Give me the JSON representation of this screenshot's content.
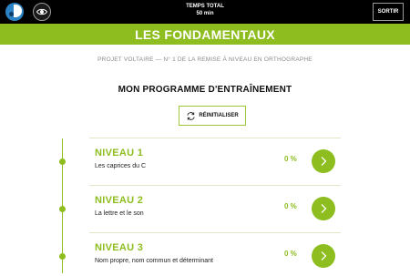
{
  "header": {
    "timer_label": "TEMPS TOTAL",
    "timer_value": "50 min",
    "exit_label": "SORTIR"
  },
  "banner": {
    "title": "LES FONDAMENTAUX"
  },
  "subtitle": "PROJET VOLTAIRE — N° 1 DE LA REMISE À NIVEAU EN ORTHOGRAPHE",
  "program_title": "MON PROGRAMME D'ENTRAÎNEMENT",
  "reset_label": "RÉINITIALISER",
  "levels": [
    {
      "name": "NIVEAU 1",
      "desc": "Les caprices du C",
      "percent": "0 %"
    },
    {
      "name": "NIVEAU 2",
      "desc": "La lettre et le son",
      "percent": "0 %"
    },
    {
      "name": "NIVEAU 3",
      "desc": "Nom propre, nom commun et déterminant",
      "percent": "0 %"
    }
  ],
  "colors": {
    "accent": "#8dbd1e",
    "topbar": "#000000",
    "logo": "#2b83c6"
  },
  "icons": [
    "logo-icon",
    "eye-icon",
    "refresh-icon",
    "chevron-right-icon"
  ]
}
